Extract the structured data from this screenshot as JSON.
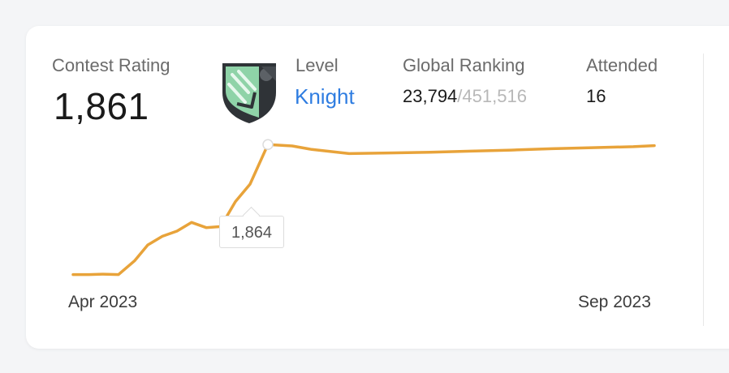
{
  "stats": {
    "contest_rating_label": "Contest Rating",
    "contest_rating_value": "1,861",
    "level_label": "Level",
    "level_value": "Knight",
    "global_ranking_label": "Global Ranking",
    "global_ranking_value": "23,794",
    "global_ranking_separator": "/",
    "global_ranking_total": "451,516",
    "attended_label": "Attended",
    "attended_value": "16"
  },
  "icons": {
    "badge": "knight-badge-icon"
  },
  "colors": {
    "line": "#e8a33a",
    "level": "#2f7de1",
    "badge_green": "#8fd3a8"
  },
  "tooltip": {
    "value": "1,864"
  },
  "chart_data": {
    "type": "line",
    "x_labels": [
      "Apr 2023",
      "Sep 2023"
    ],
    "series": [
      {
        "values": [
          1490,
          1490,
          1491,
          1490,
          1530,
          1575,
          1600,
          1615,
          1640,
          1625,
          1628,
          1700,
          1750,
          1864,
          1860,
          1850,
          1838,
          1840,
          1842,
          1845,
          1848,
          1852,
          1855,
          1858,
          1861
        ]
      }
    ],
    "highlight_index": 13,
    "ylim": [
      1300,
      2000
    ],
    "grid": false
  }
}
